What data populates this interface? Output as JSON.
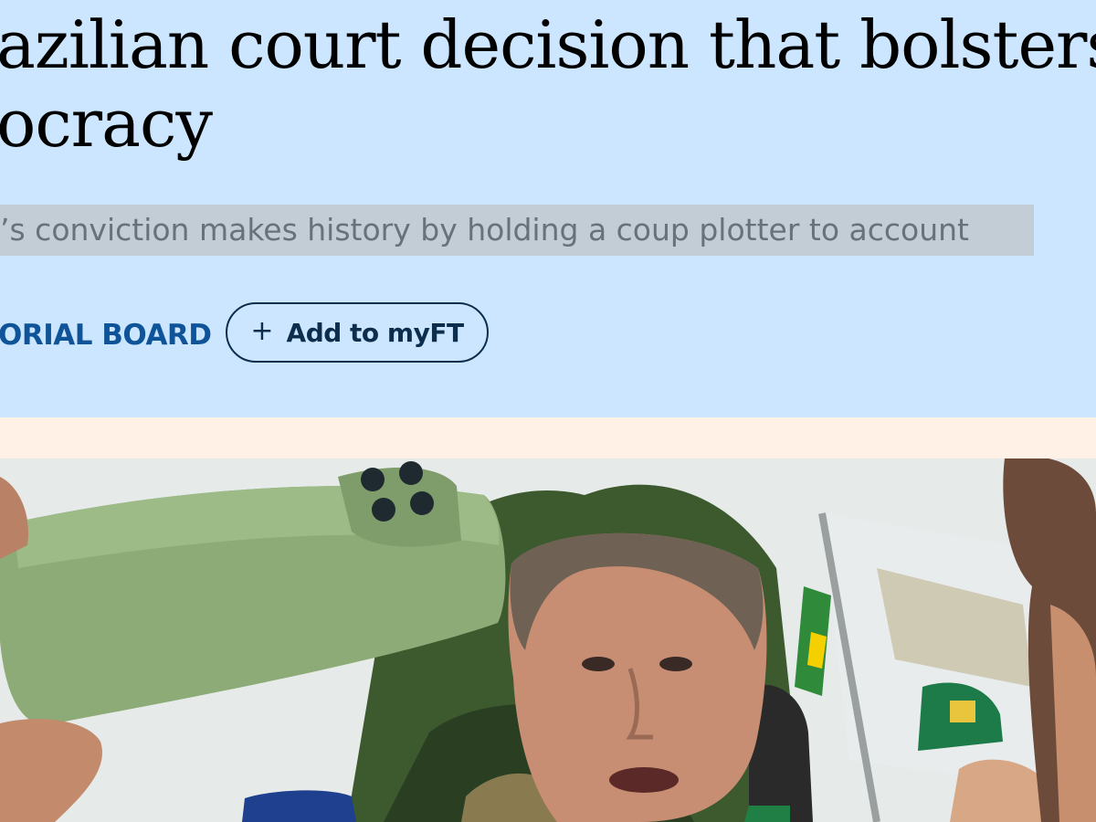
{
  "article": {
    "headline_line1": "azilian court decision that bolsters",
    "headline_line2": "ocracy",
    "standfirst": "’s conviction makes history by holding a coup plotter to account",
    "byline": "ORIAL BOARD",
    "myft_button": {
      "icon": "plus-icon",
      "plus": "+",
      "label": "Add to myFT"
    }
  },
  "colors": {
    "hero_background": "#cce6ff",
    "page_background": "#fff1e5",
    "byline": "#0f5499",
    "button_border": "#0d2d4c",
    "highlight": "#c3cdd5"
  }
}
